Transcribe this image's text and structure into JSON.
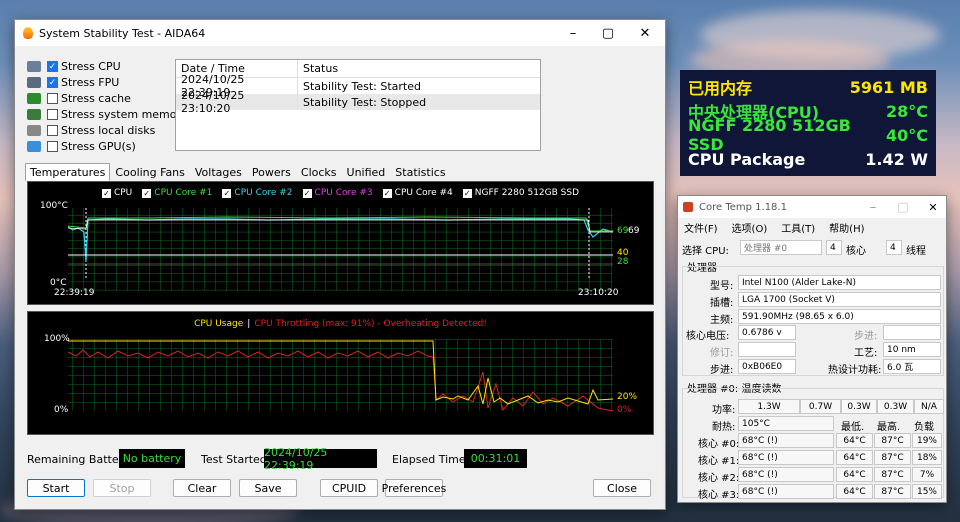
{
  "aida": {
    "title": "System Stability Test - AIDA64",
    "stress": [
      {
        "label": "Stress CPU",
        "checked": true,
        "icon": "cpu-chip-icon"
      },
      {
        "label": "Stress FPU",
        "checked": true,
        "icon": "fpu-icon"
      },
      {
        "label": "Stress cache",
        "checked": false,
        "icon": "cache-icon"
      },
      {
        "label": "Stress system memory",
        "checked": false,
        "icon": "memory-icon"
      },
      {
        "label": "Stress local disks",
        "checked": false,
        "icon": "disk-icon"
      },
      {
        "label": "Stress GPU(s)",
        "checked": false,
        "icon": "gpu-icon"
      }
    ],
    "log_headers": [
      "Date / Time",
      "Status"
    ],
    "log_rows": [
      [
        "2024/10/25 22:39:19",
        "Stability Test: Started"
      ],
      [
        "2024/10/25 23:10:20",
        "Stability Test: Stopped"
      ]
    ],
    "tabs": [
      "Temperatures",
      "Cooling Fans",
      "Voltages",
      "Powers",
      "Clocks",
      "Unified",
      "Statistics"
    ],
    "active_tab": "Temperatures",
    "temp_graph": {
      "legend": [
        {
          "label": "CPU",
          "color": "#ffffff"
        },
        {
          "label": "CPU Core #1",
          "color": "#3cdc3c"
        },
        {
          "label": "CPU Core #2",
          "color": "#3ad0e8"
        },
        {
          "label": "CPU Core #3",
          "color": "#e040e0"
        },
        {
          "label": "CPU Core #4",
          "color": "#ffffff"
        },
        {
          "label": "NGFF 2280 512GB SSD",
          "color": "#ffffff"
        }
      ],
      "y_top": "100°C",
      "y_bottom": "0°C",
      "x_start": "22:39:19",
      "x_end": "23:10:20",
      "right_values": [
        "69",
        "69",
        "40",
        "28"
      ]
    },
    "usage_graph": {
      "title_usage": "CPU Usage",
      "separator": "|",
      "title_throttle": "CPU Throttling (max: 91%) - Overheating Detected!",
      "y_top": "100%",
      "y_bottom": "0%",
      "right_usage": "20%",
      "right_throttle": "0%"
    },
    "status": {
      "battery_label": "Remaining Battery:",
      "battery_value": "No battery",
      "started_label": "Test Started:",
      "started_value": "2024/10/25 22:39:19",
      "elapsed_label": "Elapsed Time:",
      "elapsed_value": "00:31:01"
    },
    "buttons": {
      "start": "Start",
      "stop": "Stop",
      "clear": "Clear",
      "save": "Save",
      "cpuid": "CPUID",
      "preferences": "Preferences",
      "close": "Close"
    }
  },
  "osd": {
    "lines": [
      {
        "label": "已用内存",
        "value": "5961 MB",
        "color": "#ffe600"
      },
      {
        "label": "中央处理器(CPU)",
        "value": "28°C",
        "color": "#39e639"
      },
      {
        "label": "NGFF 2280 512GB SSD",
        "value": "40°C",
        "color": "#39e639"
      },
      {
        "label": "CPU Package",
        "value": "1.42 W",
        "color": "#ffffff"
      }
    ]
  },
  "coretemp": {
    "title": "Core Temp 1.18.1",
    "menu": [
      "文件(F)",
      "选项(O)",
      "工具(T)",
      "帮助(H)"
    ],
    "select_label": "选择 CPU:",
    "select_value": "处理器 #0",
    "cores_count": "4",
    "cores_label": "核心",
    "threads_count": "4",
    "threads_label": "线程",
    "processor_section": "处理器",
    "model_label": "型号:",
    "model_value": "Intel N100 (Alder Lake-N)",
    "socket_label": "插槽:",
    "socket_value": "LGA 1700 (Socket V)",
    "freq_label": "主频:",
    "freq_value": "591.90MHz (98.65 x 6.0)",
    "vid_label": "核心电压:",
    "vid_value": "0.6786 v",
    "modulation_label": "步进:",
    "revision_label": "修订:",
    "lithography_label": "工艺:",
    "lithography_value": "10 nm",
    "cpuid_label": "步进:",
    "cpuid_value": "0xB06E0",
    "tdp_label": "热设计功耗:",
    "tdp_value": "6.0 瓦",
    "temps_section": "处理器 #0: 温度读数",
    "power_label": "功率:",
    "power_values": [
      "1.3W",
      "0.7W",
      "0.3W",
      "0.3W",
      "N/A"
    ],
    "tj_label": "耐热:",
    "tj_value": "105°C",
    "min_label": "最低.",
    "max_label": "最高.",
    "load_label": "负载",
    "cores": [
      {
        "label": "核心 #0:",
        "temp": "68°C (!)",
        "min": "64°C",
        "max": "87°C",
        "load": "19%"
      },
      {
        "label": "核心 #1:",
        "temp": "68°C (!)",
        "min": "64°C",
        "max": "87°C",
        "load": "18%"
      },
      {
        "label": "核心 #2:",
        "temp": "68°C (!)",
        "min": "64°C",
        "max": "87°C",
        "load": "7%"
      },
      {
        "label": "核心 #3:",
        "temp": "68°C (!)",
        "min": "64°C",
        "max": "87°C",
        "load": "15%"
      }
    ]
  }
}
